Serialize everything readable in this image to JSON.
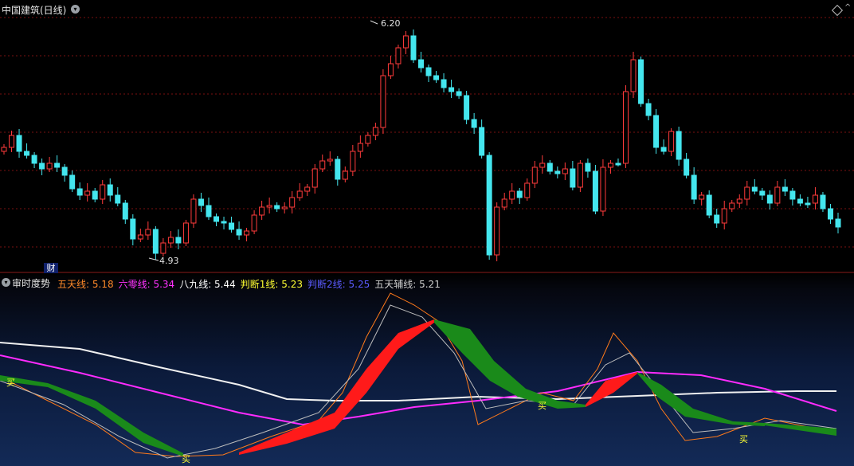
{
  "top": {
    "title": "中国建筑(日线)",
    "high_label": "6.20",
    "low_label": "4.93",
    "badge": "财"
  },
  "bottom": {
    "title": "审时度势",
    "legend": [
      {
        "name": "五天线:",
        "value": "5.18",
        "color": "#ff8a2a"
      },
      {
        "name": "六零线:",
        "value": "5.34",
        "color": "#ff33ff"
      },
      {
        "name": "八九线:",
        "value": "5.44",
        "color": "#ffffff"
      },
      {
        "name": "判断1线:",
        "value": "5.23",
        "color": "#ffff33"
      },
      {
        "name": "判断2线:",
        "value": "5.25",
        "color": "#5b5bff"
      },
      {
        "name": "五天辅线:",
        "value": "5.21",
        "color": "#cfcfcf"
      }
    ],
    "buy_label": "买"
  },
  "colors": {
    "up": "#ff3b3b",
    "down": "#44e6ee",
    "grid": "#7a1010"
  }
}
